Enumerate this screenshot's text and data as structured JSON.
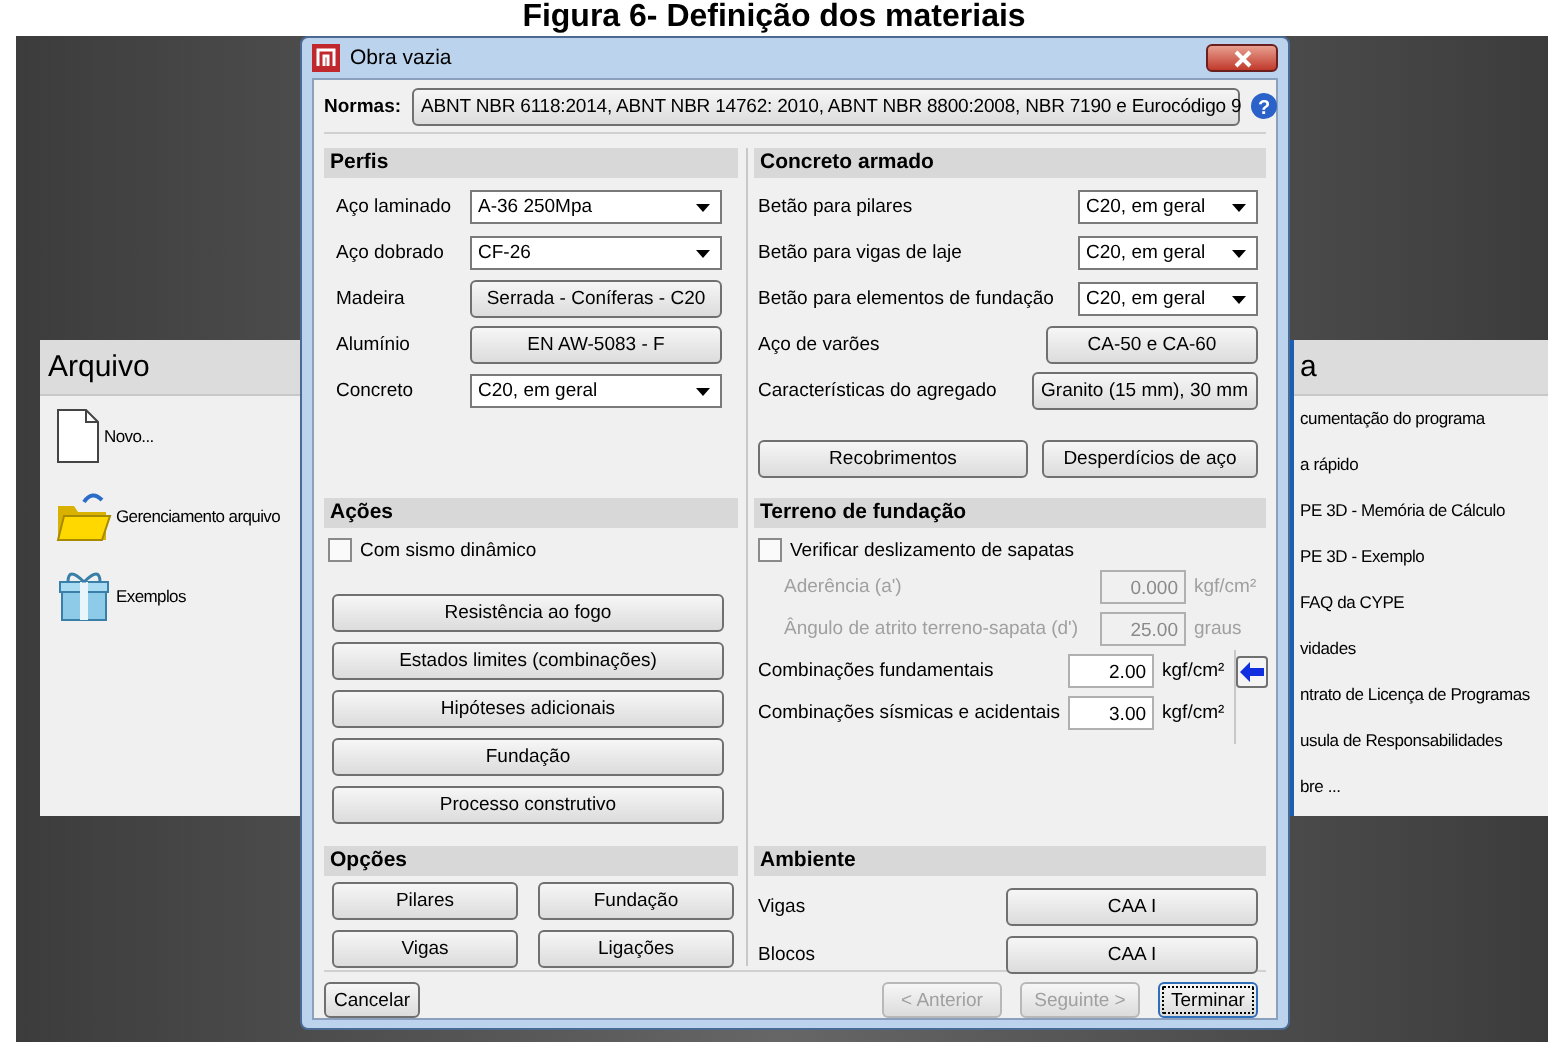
{
  "caption": "Figura 6- Definição dos materiais",
  "background_app": {
    "left_panel": {
      "title": "Arquivo",
      "items": [
        {
          "label": "Novo...",
          "kind": "file"
        },
        {
          "label": "Gerenciamento arquivo",
          "kind": "folder"
        },
        {
          "label": "Exemplos",
          "kind": "gift"
        }
      ]
    },
    "right_panel": {
      "title": "a",
      "items": [
        "cumentação do programa",
        "a rápido",
        "PE 3D - Memória de Cálculo",
        "PE 3D - Exemplo",
        "FAQ da CYPE",
        "vidades",
        "ntrato de Licença de Programas",
        "usula de Responsabilidades",
        "bre ..."
      ]
    }
  },
  "dialog": {
    "title": "Obra vazia",
    "help": "?",
    "normas": {
      "label": "Normas:",
      "value": "ABNT NBR 6118:2014, ABNT NBR 14762: 2010, ABNT NBR 8800:2008, NBR 7190 e Eurocódigo 9"
    },
    "perfis": {
      "title": "Perfis",
      "rows": [
        {
          "label": "Aço laminado",
          "value": "A-36 250Mpa",
          "kind": "dropdown"
        },
        {
          "label": "Aço dobrado",
          "value": "CF-26",
          "kind": "dropdown"
        },
        {
          "label": "Madeira",
          "value": "Serrada - Coníferas - C20",
          "kind": "button"
        },
        {
          "label": "Alumínio",
          "value": "EN AW-5083 - F",
          "kind": "button"
        },
        {
          "label": "Concreto",
          "value": "C20, em geral",
          "kind": "dropdown"
        }
      ]
    },
    "concreto_armado": {
      "title": "Concreto armado",
      "rows": [
        {
          "label": "Betão para pilares",
          "value": "C20, em geral",
          "kind": "dropdown"
        },
        {
          "label": "Betão para vigas de laje",
          "value": "C20, em geral",
          "kind": "dropdown"
        },
        {
          "label": "Betão para elementos de fundação",
          "value": "C20, em geral",
          "kind": "dropdown"
        },
        {
          "label": "Aço de varões",
          "value": "CA-50 e CA-60",
          "kind": "button"
        },
        {
          "label": "Características do agregado",
          "value": "Granito (15 mm), 30 mm",
          "kind": "button"
        }
      ],
      "buttons": [
        "Recobrimentos",
        "Desperdícios de aço"
      ]
    },
    "acoes": {
      "title": "Ações",
      "checkbox": {
        "label": "Com sismo dinâmico",
        "checked": false
      },
      "buttons": [
        "Resistência ao fogo",
        "Estados limites (combinações)",
        "Hipóteses adicionais",
        "Fundação",
        "Processo construtivo"
      ]
    },
    "terreno": {
      "title": "Terreno de fundação",
      "checkbox": {
        "label": "Verificar deslizamento de sapatas",
        "checked": false
      },
      "fields": [
        {
          "label": "Aderência (a')",
          "value": "0.000",
          "unit": "kgf/cm²",
          "disabled": true
        },
        {
          "label": "Ângulo de atrito terreno-sapata (d')",
          "value": "25.00",
          "unit": "graus",
          "disabled": true
        },
        {
          "label": "Combinações fundamentais",
          "value": "2.00",
          "unit": "kgf/cm²",
          "disabled": false
        },
        {
          "label": "Combinações sísmicas e acidentais",
          "value": "3.00",
          "unit": "kgf/cm²",
          "disabled": false
        }
      ]
    },
    "opcoes": {
      "title": "Opções",
      "buttons": [
        "Pilares",
        "Fundação",
        "Vigas",
        "Ligações"
      ]
    },
    "ambiente": {
      "title": "Ambiente",
      "rows": [
        {
          "label": "Vigas",
          "value": "CAA I"
        },
        {
          "label": "Blocos",
          "value": "CAA I"
        }
      ]
    },
    "footer": [
      {
        "label": "Cancelar",
        "disabled": false,
        "focused": false
      },
      {
        "label": "< Anterior",
        "disabled": true,
        "focused": false
      },
      {
        "label": "Seguinte >",
        "disabled": true,
        "focused": false
      },
      {
        "label": "Terminar",
        "disabled": false,
        "focused": true
      }
    ]
  }
}
